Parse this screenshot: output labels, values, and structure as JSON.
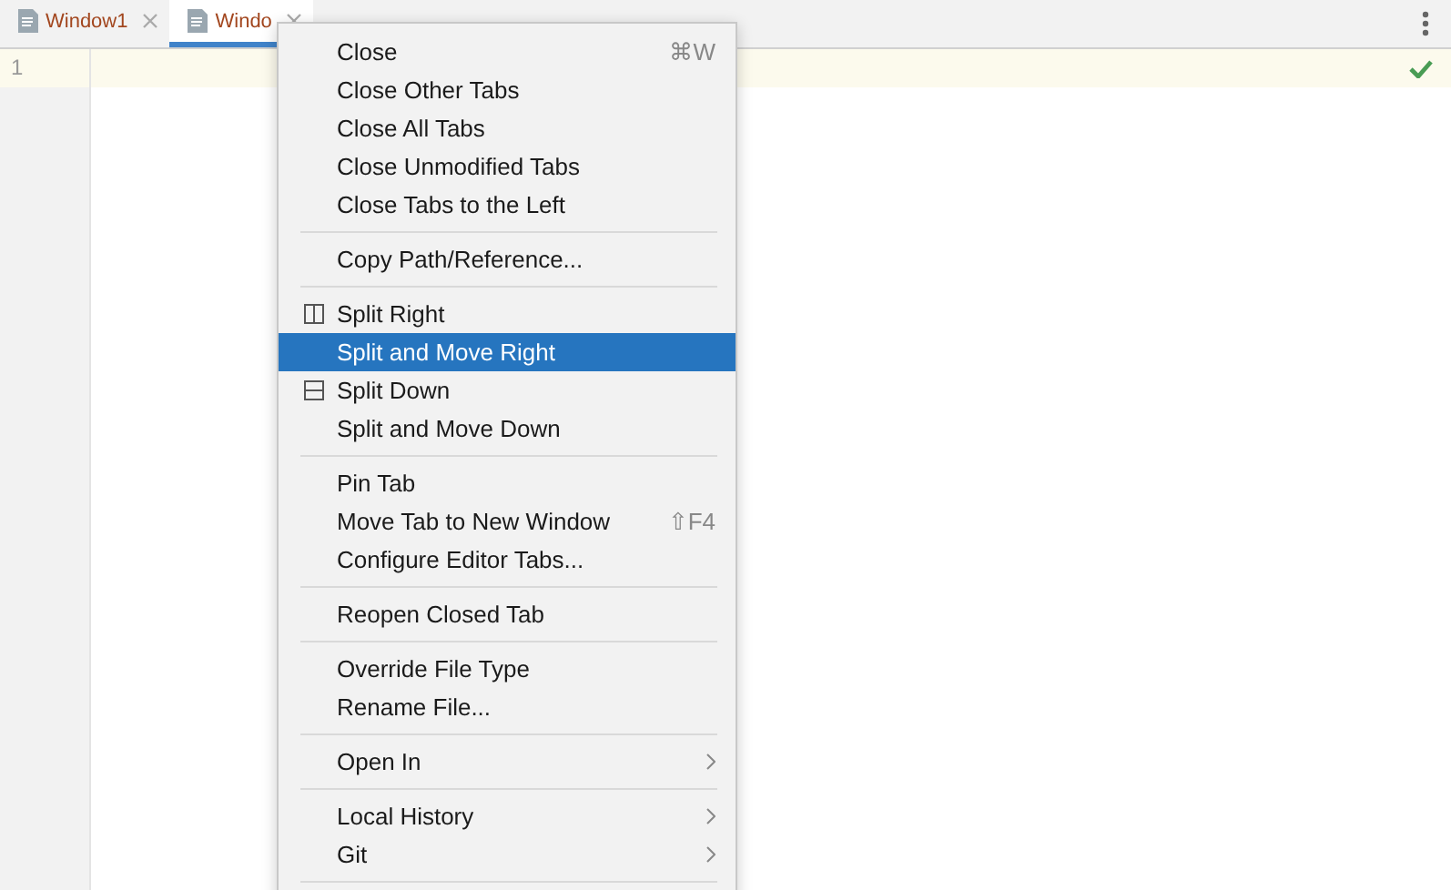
{
  "tabs": [
    {
      "label": "Window1",
      "selected": false
    },
    {
      "label": "Windo",
      "selected": true
    }
  ],
  "editor": {
    "line_numbers": [
      "1"
    ]
  },
  "menu": [
    {
      "kind": "item",
      "label": "Close",
      "shortcut": "⌘W",
      "selected": false
    },
    {
      "kind": "item",
      "label": "Close Other Tabs",
      "selected": false
    },
    {
      "kind": "item",
      "label": "Close All Tabs",
      "selected": false
    },
    {
      "kind": "item",
      "label": "Close Unmodified Tabs",
      "selected": false
    },
    {
      "kind": "item",
      "label": "Close Tabs to the Left",
      "selected": false
    },
    {
      "kind": "separator"
    },
    {
      "kind": "item",
      "label": "Copy Path/Reference...",
      "selected": false
    },
    {
      "kind": "separator"
    },
    {
      "kind": "vsplit",
      "label": "Split Right",
      "selected": false
    },
    {
      "kind": "item",
      "label": "Split and Move Right",
      "selected": true
    },
    {
      "kind": "hsplit",
      "label": "Split Down",
      "selected": false
    },
    {
      "kind": "item",
      "label": "Split and Move Down",
      "selected": false
    },
    {
      "kind": "separator"
    },
    {
      "kind": "item",
      "label": "Pin Tab",
      "selected": false
    },
    {
      "kind": "item",
      "label": "Move Tab to New Window",
      "shortcut": "⇧F4",
      "selected": false
    },
    {
      "kind": "item",
      "label": "Configure Editor Tabs...",
      "selected": false
    },
    {
      "kind": "separator"
    },
    {
      "kind": "item",
      "label": "Reopen Closed Tab",
      "selected": false
    },
    {
      "kind": "separator"
    },
    {
      "kind": "item",
      "label": "Override File Type",
      "selected": false
    },
    {
      "kind": "item",
      "label": "Rename File...",
      "selected": false
    },
    {
      "kind": "separator"
    },
    {
      "kind": "item",
      "label": "Open In",
      "submenu": true,
      "selected": false
    },
    {
      "kind": "separator"
    },
    {
      "kind": "item",
      "label": "Local History",
      "submenu": true,
      "selected": false
    },
    {
      "kind": "item",
      "label": "Git",
      "submenu": true,
      "selected": false
    },
    {
      "kind": "separator"
    }
  ]
}
